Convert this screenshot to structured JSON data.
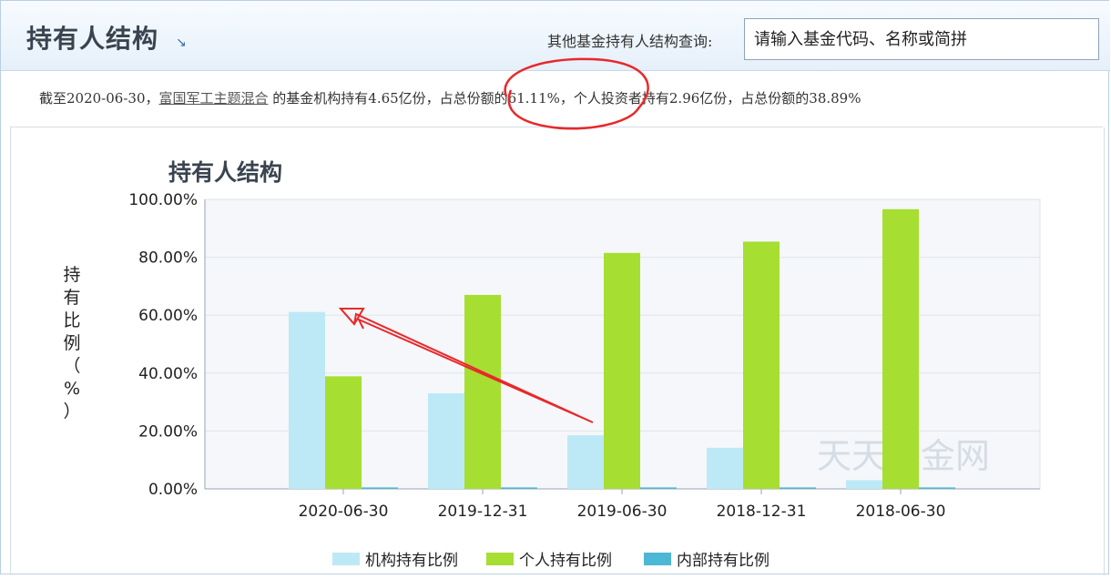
{
  "header": {
    "title": "持有人结构",
    "title_icon": "expand-arrow-icon",
    "query_label": "其他基金持有人结构查询:",
    "search_placeholder": "请输入基金代码、名称或简拼"
  },
  "summary": {
    "prefix": "截至2020-06-30，",
    "fund_link": "富国军工主题混合",
    "text": " 的基金机构持有4.65亿份，占总份额的61.11%，个人投资者持有2.96亿份，占总份额的38.89%"
  },
  "chart_data": {
    "type": "bar",
    "title": "持有人结构",
    "ylabel": "持有比例（%）",
    "categories": [
      "2020-06-30",
      "2019-12-31",
      "2019-06-30",
      "2018-12-31",
      "2018-06-30"
    ],
    "series": [
      {
        "name": "机构持有比例",
        "values": [
          61.11,
          33.0,
          18.5,
          14.2,
          3.0
        ],
        "color": "#bde9f7"
      },
      {
        "name": "个人持有比例",
        "values": [
          38.89,
          67.0,
          81.5,
          85.4,
          96.6
        ],
        "color": "#a6de32"
      },
      {
        "name": "内部持有比例",
        "values": [
          0.5,
          0.5,
          0.5,
          0.5,
          0.5
        ],
        "color": "#4db7d6"
      }
    ],
    "yticks": [
      "0.00%",
      "20.00%",
      "40.00%",
      "60.00%",
      "80.00%",
      "100.00%"
    ],
    "ylim": [
      0,
      100
    ],
    "watermark": "天天基金网",
    "legend_position": "bottom"
  }
}
